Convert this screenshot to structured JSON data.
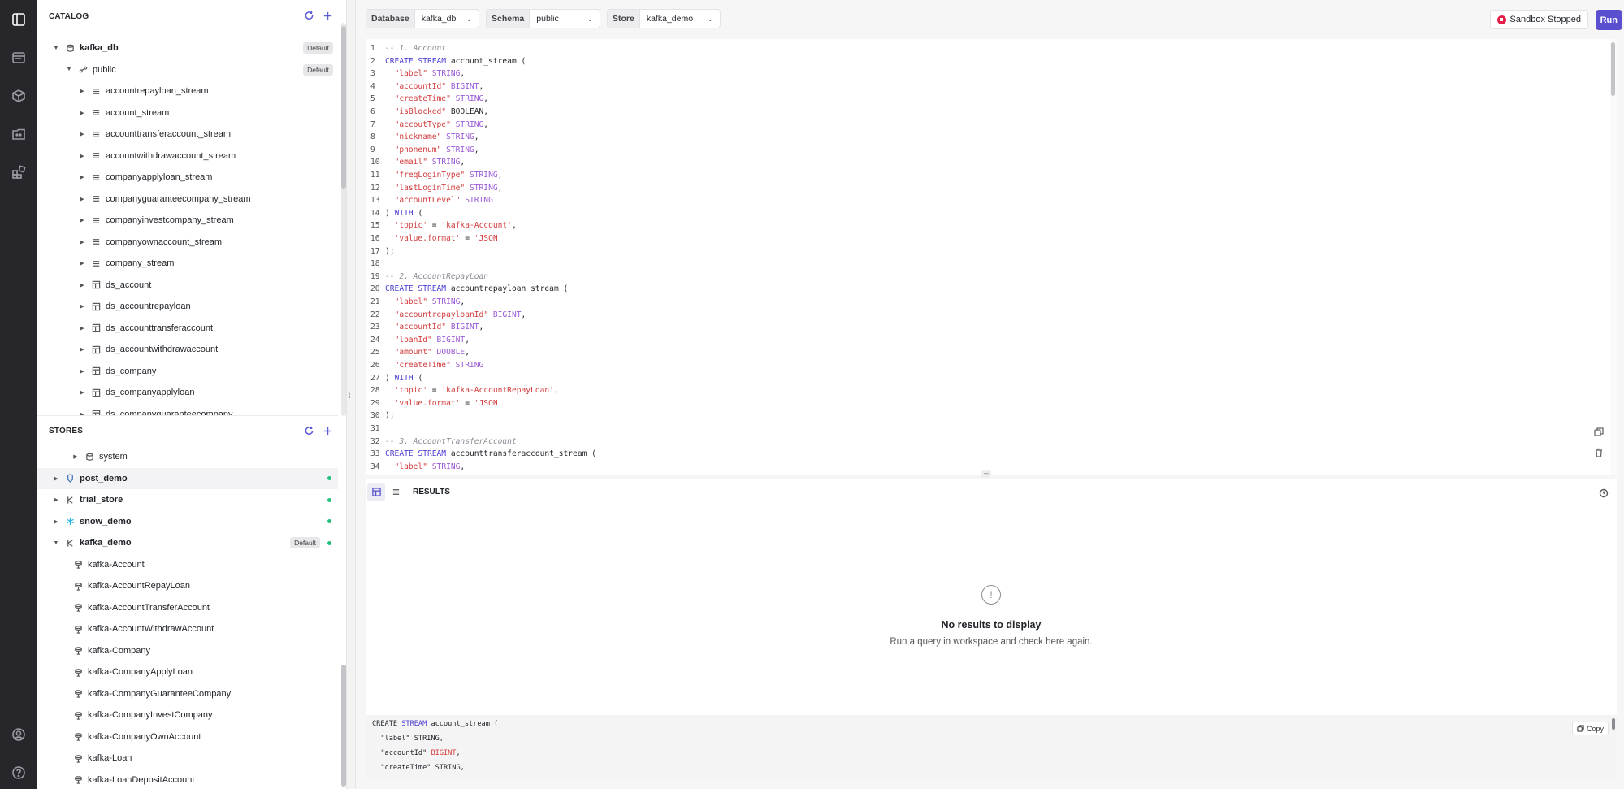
{
  "catalog": {
    "title": "CATALOG",
    "db": {
      "name": "kafka_db",
      "badge": "Default"
    },
    "schema": {
      "name": "public",
      "badge": "Default"
    },
    "items": [
      {
        "name": "accountrepayloan_stream",
        "icon": "stream-icon"
      },
      {
        "name": "account_stream",
        "icon": "stream-icon"
      },
      {
        "name": "accounttransferaccount_stream",
        "icon": "stream-icon"
      },
      {
        "name": "accountwithdrawaccount_stream",
        "icon": "stream-icon"
      },
      {
        "name": "companyapplyloan_stream",
        "icon": "stream-icon"
      },
      {
        "name": "companyguaranteecompany_stream",
        "icon": "stream-icon"
      },
      {
        "name": "companyinvestcompany_stream",
        "icon": "stream-icon"
      },
      {
        "name": "companyownaccount_stream",
        "icon": "stream-icon"
      },
      {
        "name": "company_stream",
        "icon": "stream-icon"
      },
      {
        "name": "ds_account",
        "icon": "table-icon"
      },
      {
        "name": "ds_accountrepayloan",
        "icon": "table-icon"
      },
      {
        "name": "ds_accounttransferaccount",
        "icon": "table-icon"
      },
      {
        "name": "ds_accountwithdrawaccount",
        "icon": "table-icon"
      },
      {
        "name": "ds_company",
        "icon": "table-icon"
      },
      {
        "name": "ds_companyapplyloan",
        "icon": "table-icon"
      },
      {
        "name": "ds_companyguaranteecompany",
        "icon": "table-icon"
      }
    ]
  },
  "stores": {
    "title": "STORES",
    "system": "system",
    "list": [
      {
        "name": "post_demo",
        "icon": "postgres-icon"
      },
      {
        "name": "trial_store",
        "icon": "kafka-icon"
      },
      {
        "name": "snow_demo",
        "icon": "snowflake-icon"
      }
    ],
    "active": {
      "name": "kafka_demo",
      "badge": "Default"
    },
    "topics": [
      "kafka-Account",
      "kafka-AccountRepayLoan",
      "kafka-AccountTransferAccount",
      "kafka-AccountWithdrawAccount",
      "kafka-Company",
      "kafka-CompanyApplyLoan",
      "kafka-CompanyGuaranteeCompany",
      "kafka-CompanyInvestCompany",
      "kafka-CompanyOwnAccount",
      "kafka-Loan",
      "kafka-LoanDepositAccount"
    ]
  },
  "toolbar": {
    "database": {
      "label": "Database",
      "value": "kafka_db"
    },
    "schema": {
      "label": "Schema",
      "value": "public"
    },
    "store": {
      "label": "Store",
      "value": "kafka_demo"
    },
    "sandbox": "Sandbox Stopped",
    "run": "Run"
  },
  "editor": {
    "lines": [
      [
        [
          "cm",
          "-- 1. Account"
        ]
      ],
      [
        [
          "kw",
          "CREATE STREAM "
        ],
        [
          "tx",
          "account_stream ("
        ]
      ],
      [
        [
          "str",
          "  \"label\" "
        ],
        [
          "ty",
          "STRING"
        ],
        [
          "tx",
          ","
        ]
      ],
      [
        [
          "str",
          "  \"accountId\" "
        ],
        [
          "ty",
          "BIGINT"
        ],
        [
          "tx",
          ","
        ]
      ],
      [
        [
          "str",
          "  \"createTime\" "
        ],
        [
          "ty",
          "STRING"
        ],
        [
          "tx",
          ","
        ]
      ],
      [
        [
          "str",
          "  \"isBlocked\" "
        ],
        [
          "tx",
          "BOOLEAN,"
        ]
      ],
      [
        [
          "str",
          "  \"accoutType\" "
        ],
        [
          "ty",
          "STRING"
        ],
        [
          "tx",
          ","
        ]
      ],
      [
        [
          "str",
          "  \"nickname\" "
        ],
        [
          "ty",
          "STRING"
        ],
        [
          "tx",
          ","
        ]
      ],
      [
        [
          "str",
          "  \"phonenum\" "
        ],
        [
          "ty",
          "STRING"
        ],
        [
          "tx",
          ","
        ]
      ],
      [
        [
          "str",
          "  \"email\" "
        ],
        [
          "ty",
          "STRING"
        ],
        [
          "tx",
          ","
        ]
      ],
      [
        [
          "str",
          "  \"freqLoginType\" "
        ],
        [
          "ty",
          "STRING"
        ],
        [
          "tx",
          ","
        ]
      ],
      [
        [
          "str",
          "  \"lastLoginTime\" "
        ],
        [
          "ty",
          "STRING"
        ],
        [
          "tx",
          ","
        ]
      ],
      [
        [
          "str",
          "  \"accountLevel\" "
        ],
        [
          "ty",
          "STRING"
        ]
      ],
      [
        [
          "tx",
          ") "
        ],
        [
          "kw",
          "WITH"
        ],
        [
          "tx",
          " ("
        ]
      ],
      [
        [
          "str",
          "  'topic'"
        ],
        [
          "tx",
          " = "
        ],
        [
          "str",
          "'kafka-Account'"
        ],
        [
          "tx",
          ","
        ]
      ],
      [
        [
          "str",
          "  'value.format'"
        ],
        [
          "tx",
          " = "
        ],
        [
          "str",
          "'JSON'"
        ]
      ],
      [
        [
          "tx",
          ");"
        ]
      ],
      [
        [
          "tx",
          ""
        ]
      ],
      [
        [
          "cm",
          "-- 2. AccountRepayLoan"
        ]
      ],
      [
        [
          "kw",
          "CREATE STREAM "
        ],
        [
          "tx",
          "accountrepayloan_stream ("
        ]
      ],
      [
        [
          "str",
          "  \"label\" "
        ],
        [
          "ty",
          "STRING"
        ],
        [
          "tx",
          ","
        ]
      ],
      [
        [
          "str",
          "  \"accountrepayloanId\" "
        ],
        [
          "ty",
          "BIGINT"
        ],
        [
          "tx",
          ","
        ]
      ],
      [
        [
          "str",
          "  \"accountId\" "
        ],
        [
          "ty",
          "BIGINT"
        ],
        [
          "tx",
          ","
        ]
      ],
      [
        [
          "str",
          "  \"loanId\" "
        ],
        [
          "ty",
          "BIGINT"
        ],
        [
          "tx",
          ","
        ]
      ],
      [
        [
          "str",
          "  \"amount\" "
        ],
        [
          "ty",
          "DOUBLE"
        ],
        [
          "tx",
          ","
        ]
      ],
      [
        [
          "str",
          "  \"createTime\" "
        ],
        [
          "ty",
          "STRING"
        ]
      ],
      [
        [
          "tx",
          ") "
        ],
        [
          "kw",
          "WITH"
        ],
        [
          "tx",
          " ("
        ]
      ],
      [
        [
          "str",
          "  'topic'"
        ],
        [
          "tx",
          " = "
        ],
        [
          "str",
          "'kafka-AccountRepayLoan'"
        ],
        [
          "tx",
          ","
        ]
      ],
      [
        [
          "str",
          "  'value.format'"
        ],
        [
          "tx",
          " = "
        ],
        [
          "str",
          "'JSON'"
        ]
      ],
      [
        [
          "tx",
          ");"
        ]
      ],
      [
        [
          "tx",
          ""
        ]
      ],
      [
        [
          "cm",
          "-- 3. AccountTransferAccount"
        ]
      ],
      [
        [
          "kw",
          "CREATE STREAM "
        ],
        [
          "tx",
          "accounttransferaccount_stream ("
        ]
      ],
      [
        [
          "str",
          "  \"label\" "
        ],
        [
          "ty",
          "STRING"
        ],
        [
          "tx",
          ","
        ]
      ]
    ]
  },
  "results": {
    "title": "RESULTS",
    "empty_title": "No results to display",
    "empty_sub": "Run a query in workspace and check here again.",
    "copy": "Copy",
    "preview": [
      [
        [
          "tx",
          "CREATE "
        ],
        [
          "kw",
          "STREAM "
        ],
        [
          "tx",
          "account_stream ("
        ]
      ],
      [
        [
          "tx",
          "  \"label\" STRING,"
        ]
      ],
      [
        [
          "tx",
          "  \"accountId\" "
        ],
        [
          "str",
          "BIGINT"
        ],
        [
          "tx",
          ","
        ]
      ],
      [
        [
          "tx",
          "  \"createTime\" STRING,"
        ]
      ]
    ]
  },
  "colors": {
    "accent": "#5a4fcf",
    "status_green": "#23c17a",
    "stop_red": "#e11d48",
    "rail": "#26262b"
  }
}
